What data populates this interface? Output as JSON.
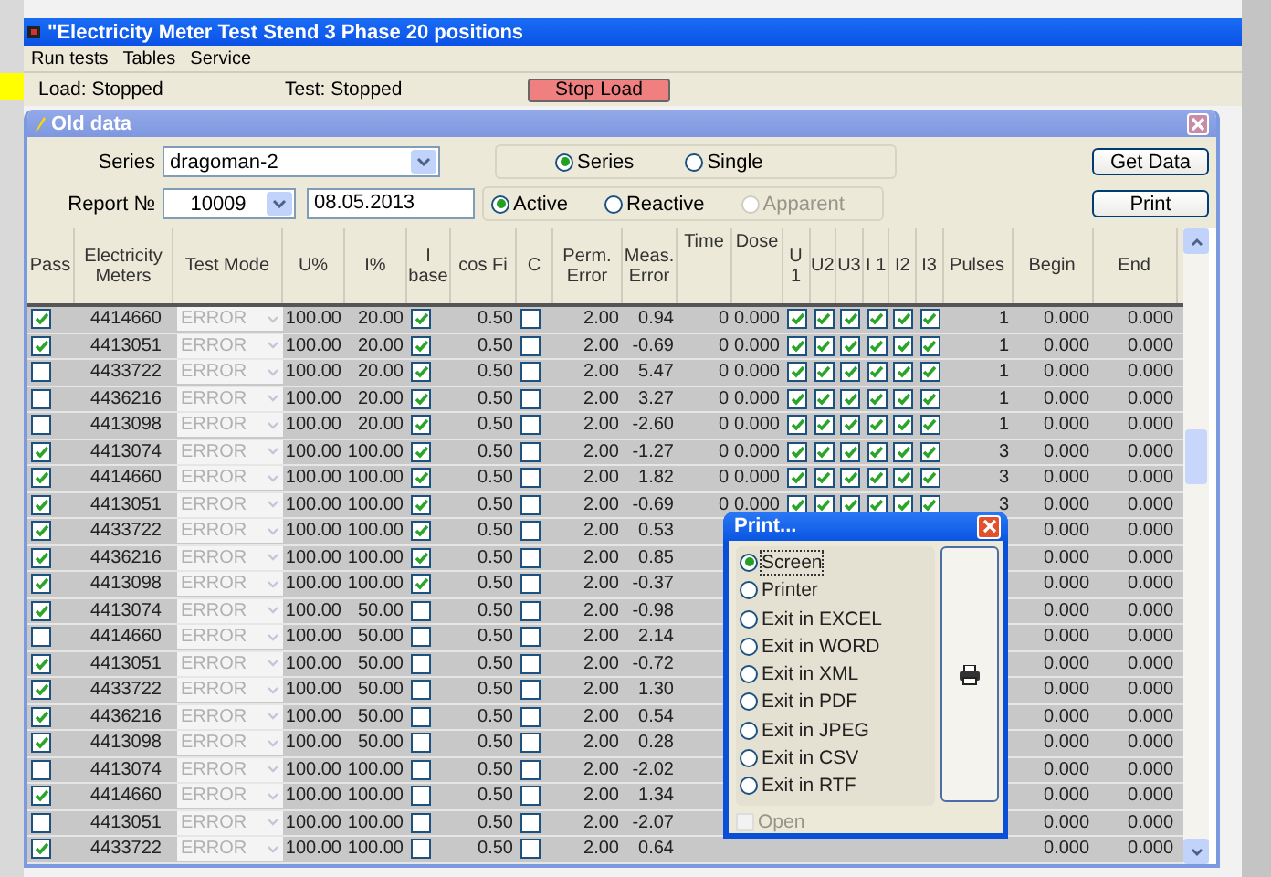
{
  "window": {
    "title": "\"Electricity Meter Test Stend 3 Phase 20 positions"
  },
  "menu": [
    "Run tests",
    "Tables",
    "Service"
  ],
  "status": {
    "load": "Load: Stopped",
    "test": "Test: Stopped",
    "stop_button": "Stop Load"
  },
  "dialog": {
    "title": "Old data",
    "series_label": "Series",
    "series_value": "dragoman-2",
    "report_label": "Report №",
    "report_value": "10009",
    "date": "08.05.2013",
    "mode_options": [
      {
        "label": "Series",
        "selected": true,
        "disabled": false
      },
      {
        "label": "Single",
        "selected": false,
        "disabled": false
      }
    ],
    "energy_options": [
      {
        "label": "Active",
        "selected": true,
        "disabled": false
      },
      {
        "label": "Reactive",
        "selected": false,
        "disabled": false
      },
      {
        "label": "Apparent",
        "selected": false,
        "disabled": true
      }
    ],
    "buttons": [
      "Get Data",
      "Print"
    ]
  },
  "table": {
    "columns": [
      "Pass",
      "Electricity Meters",
      "Test Mode",
      "U%",
      "I%",
      "I base",
      "cos Fi",
      "C",
      "Perm. Error",
      "Meas. Error",
      "Time",
      "Dose",
      "U 1",
      "U2",
      "U3",
      "I 1",
      "I2",
      "I3",
      "Pulses",
      "Begin",
      "End"
    ],
    "rows": [
      {
        "pass": true,
        "meter": "4414660",
        "mode": "ERROR",
        "u": "100.00",
        "i": "20.00",
        "ibase": true,
        "cos": "0.50",
        "c": false,
        "perm": "2.00",
        "meas": "0.94",
        "time": "0",
        "dose": "0.000",
        "phases": [
          true,
          true,
          true,
          true,
          true,
          true
        ],
        "pulses": "1",
        "begin": "0.000",
        "end": "0.000"
      },
      {
        "pass": true,
        "meter": "4413051",
        "mode": "ERROR",
        "u": "100.00",
        "i": "20.00",
        "ibase": true,
        "cos": "0.50",
        "c": false,
        "perm": "2.00",
        "meas": "-0.69",
        "time": "0",
        "dose": "0.000",
        "phases": [
          true,
          true,
          true,
          true,
          true,
          true
        ],
        "pulses": "1",
        "begin": "0.000",
        "end": "0.000"
      },
      {
        "pass": false,
        "meter": "4433722",
        "mode": "ERROR",
        "u": "100.00",
        "i": "20.00",
        "ibase": true,
        "cos": "0.50",
        "c": false,
        "perm": "2.00",
        "meas": "5.47",
        "time": "0",
        "dose": "0.000",
        "phases": [
          true,
          true,
          true,
          true,
          true,
          true
        ],
        "pulses": "1",
        "begin": "0.000",
        "end": "0.000"
      },
      {
        "pass": false,
        "meter": "4436216",
        "mode": "ERROR",
        "u": "100.00",
        "i": "20.00",
        "ibase": true,
        "cos": "0.50",
        "c": false,
        "perm": "2.00",
        "meas": "3.27",
        "time": "0",
        "dose": "0.000",
        "phases": [
          true,
          true,
          true,
          true,
          true,
          true
        ],
        "pulses": "1",
        "begin": "0.000",
        "end": "0.000"
      },
      {
        "pass": false,
        "meter": "4413098",
        "mode": "ERROR",
        "u": "100.00",
        "i": "20.00",
        "ibase": true,
        "cos": "0.50",
        "c": false,
        "perm": "2.00",
        "meas": "-2.60",
        "time": "0",
        "dose": "0.000",
        "phases": [
          true,
          true,
          true,
          true,
          true,
          true
        ],
        "pulses": "1",
        "begin": "0.000",
        "end": "0.000"
      },
      {
        "pass": true,
        "meter": "4413074",
        "mode": "ERROR",
        "u": "100.00",
        "i": "100.00",
        "ibase": true,
        "cos": "0.50",
        "c": false,
        "perm": "2.00",
        "meas": "-1.27",
        "time": "0",
        "dose": "0.000",
        "phases": [
          true,
          true,
          true,
          true,
          true,
          true
        ],
        "pulses": "3",
        "begin": "0.000",
        "end": "0.000"
      },
      {
        "pass": true,
        "meter": "4414660",
        "mode": "ERROR",
        "u": "100.00",
        "i": "100.00",
        "ibase": true,
        "cos": "0.50",
        "c": false,
        "perm": "2.00",
        "meas": "1.82",
        "time": "0",
        "dose": "0.000",
        "phases": [
          true,
          true,
          true,
          true,
          true,
          true
        ],
        "pulses": "3",
        "begin": "0.000",
        "end": "0.000"
      },
      {
        "pass": true,
        "meter": "4413051",
        "mode": "ERROR",
        "u": "100.00",
        "i": "100.00",
        "ibase": true,
        "cos": "0.50",
        "c": false,
        "perm": "2.00",
        "meas": "-0.69",
        "time": "0",
        "dose": "0.000",
        "phases": [
          true,
          true,
          true,
          true,
          true,
          true
        ],
        "pulses": "3",
        "begin": "0.000",
        "end": "0.000"
      },
      {
        "pass": true,
        "meter": "4433722",
        "mode": "ERROR",
        "u": "100.00",
        "i": "100.00",
        "ibase": true,
        "cos": "0.50",
        "c": false,
        "perm": "2.00",
        "meas": "0.53",
        "begin": "0.000",
        "end": "0.000"
      },
      {
        "pass": true,
        "meter": "4436216",
        "mode": "ERROR",
        "u": "100.00",
        "i": "100.00",
        "ibase": true,
        "cos": "0.50",
        "c": false,
        "perm": "2.00",
        "meas": "0.85",
        "begin": "0.000",
        "end": "0.000"
      },
      {
        "pass": true,
        "meter": "4413098",
        "mode": "ERROR",
        "u": "100.00",
        "i": "100.00",
        "ibase": true,
        "cos": "0.50",
        "c": false,
        "perm": "2.00",
        "meas": "-0.37",
        "begin": "0.000",
        "end": "0.000"
      },
      {
        "pass": true,
        "meter": "4413074",
        "mode": "ERROR",
        "u": "100.00",
        "i": "50.00",
        "ibase": false,
        "cos": "0.50",
        "c": false,
        "perm": "2.00",
        "meas": "-0.98",
        "begin": "0.000",
        "end": "0.000"
      },
      {
        "pass": false,
        "meter": "4414660",
        "mode": "ERROR",
        "u": "100.00",
        "i": "50.00",
        "ibase": false,
        "cos": "0.50",
        "c": false,
        "perm": "2.00",
        "meas": "2.14",
        "begin": "0.000",
        "end": "0.000"
      },
      {
        "pass": true,
        "meter": "4413051",
        "mode": "ERROR",
        "u": "100.00",
        "i": "50.00",
        "ibase": false,
        "cos": "0.50",
        "c": false,
        "perm": "2.00",
        "meas": "-0.72",
        "begin": "0.000",
        "end": "0.000"
      },
      {
        "pass": true,
        "meter": "4433722",
        "mode": "ERROR",
        "u": "100.00",
        "i": "50.00",
        "ibase": false,
        "cos": "0.50",
        "c": false,
        "perm": "2.00",
        "meas": "1.30",
        "begin": "0.000",
        "end": "0.000"
      },
      {
        "pass": true,
        "meter": "4436216",
        "mode": "ERROR",
        "u": "100.00",
        "i": "50.00",
        "ibase": false,
        "cos": "0.50",
        "c": false,
        "perm": "2.00",
        "meas": "0.54",
        "begin": "0.000",
        "end": "0.000"
      },
      {
        "pass": true,
        "meter": "4413098",
        "mode": "ERROR",
        "u": "100.00",
        "i": "50.00",
        "ibase": false,
        "cos": "0.50",
        "c": false,
        "perm": "2.00",
        "meas": "0.28",
        "begin": "0.000",
        "end": "0.000"
      },
      {
        "pass": false,
        "meter": "4413074",
        "mode": "ERROR",
        "u": "100.00",
        "i": "100.00",
        "ibase": false,
        "cos": "0.50",
        "c": false,
        "perm": "2.00",
        "meas": "-2.02",
        "begin": "0.000",
        "end": "0.000"
      },
      {
        "pass": true,
        "meter": "4414660",
        "mode": "ERROR",
        "u": "100.00",
        "i": "100.00",
        "ibase": false,
        "cos": "0.50",
        "c": false,
        "perm": "2.00",
        "meas": "1.34",
        "begin": "0.000",
        "end": "0.000"
      },
      {
        "pass": false,
        "meter": "4413051",
        "mode": "ERROR",
        "u": "100.00",
        "i": "100.00",
        "ibase": false,
        "cos": "0.50",
        "c": false,
        "perm": "2.00",
        "meas": "-2.07",
        "begin": "0.000",
        "end": "0.000"
      },
      {
        "pass": true,
        "meter": "4433722",
        "mode": "ERROR",
        "u": "100.00",
        "i": "100.00",
        "ibase": false,
        "cos": "0.50",
        "c": false,
        "perm": "2.00",
        "meas": "0.64",
        "begin": "0.000",
        "end": "0.000"
      }
    ]
  },
  "print_popup": {
    "title": "Print...",
    "options": [
      {
        "label": "Screen",
        "selected": true
      },
      {
        "label": "Printer",
        "selected": false
      },
      {
        "label": "Exit in EXCEL",
        "selected": false
      },
      {
        "label": "Exit in WORD",
        "selected": false
      },
      {
        "label": "Exit in XML",
        "selected": false
      },
      {
        "label": "Exit in PDF",
        "selected": false
      },
      {
        "label": "Exit in JPEG",
        "selected": false
      },
      {
        "label": "Exit in CSV",
        "selected": false
      },
      {
        "label": "Exit in RTF",
        "selected": false
      }
    ],
    "open": {
      "label": "Open",
      "checked": false,
      "disabled": true
    }
  }
}
